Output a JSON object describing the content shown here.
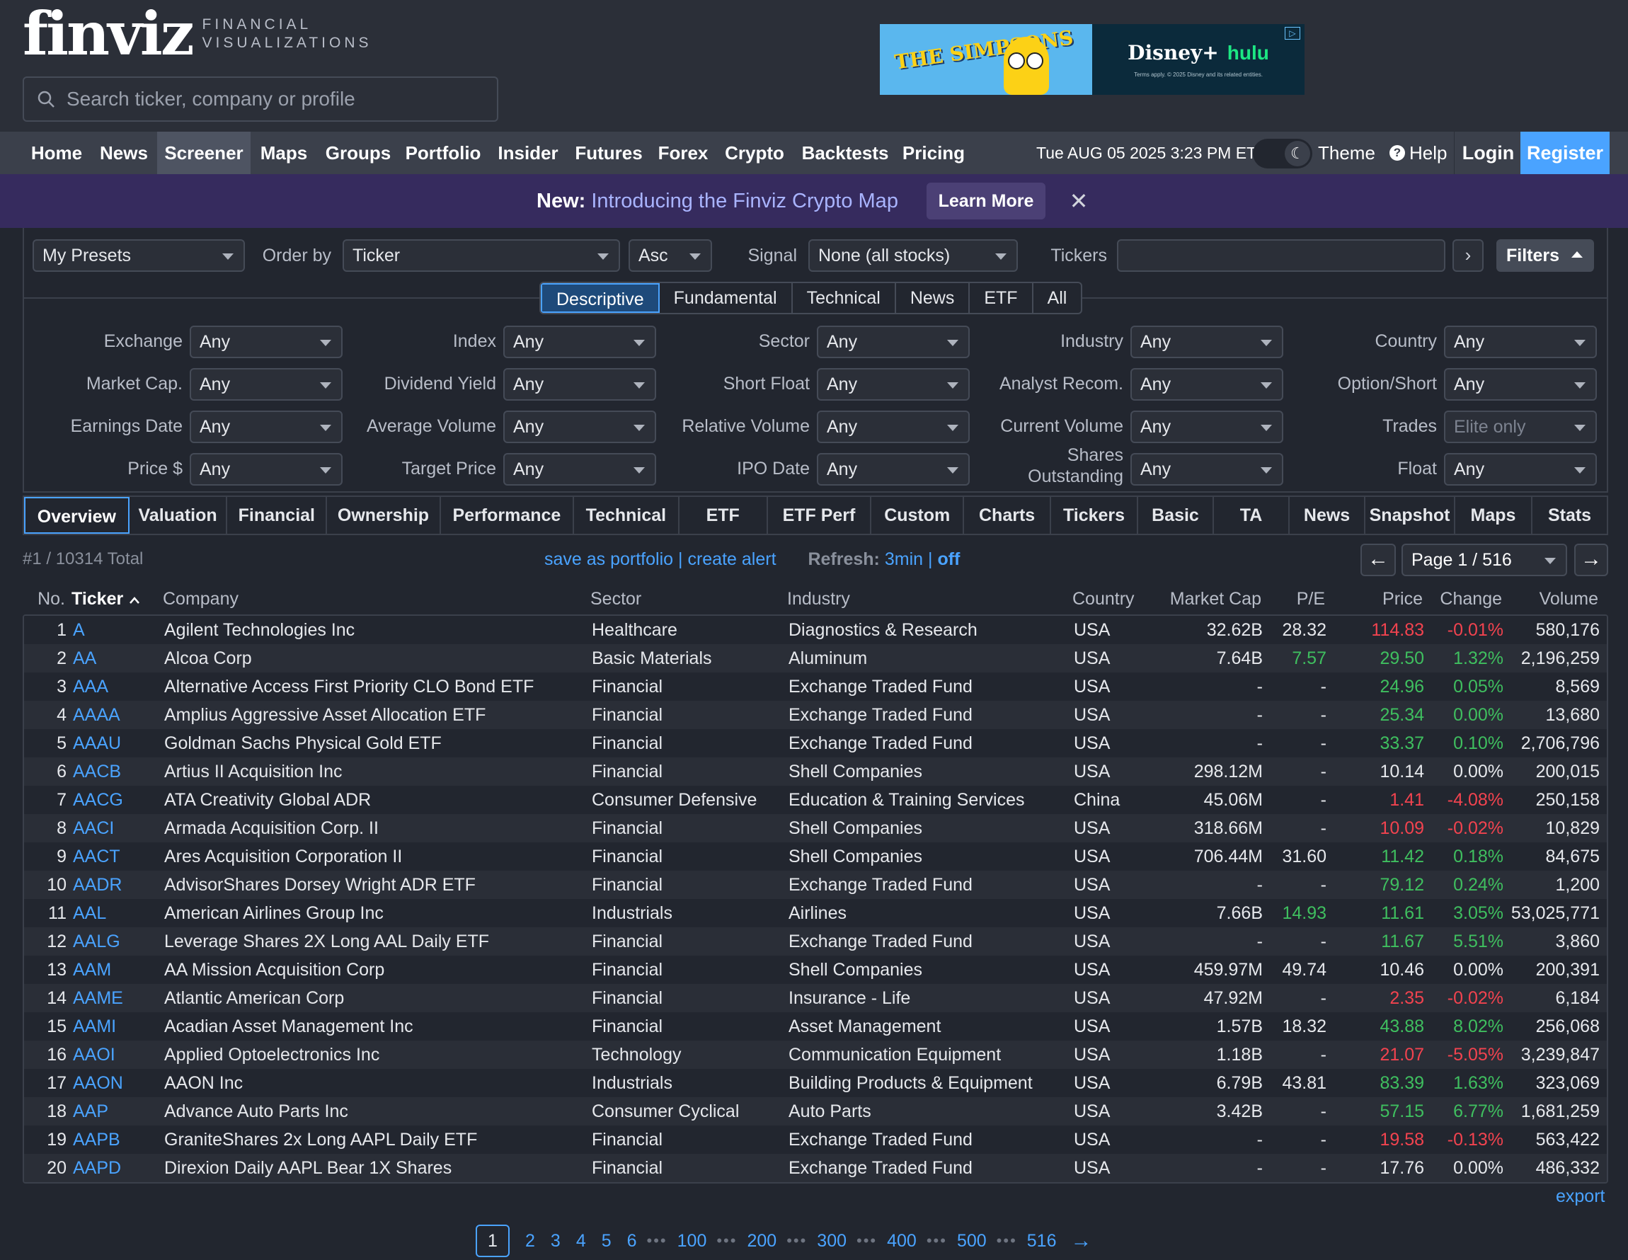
{
  "header": {
    "logo_text": "finviz",
    "logo_sub_1": "FINANCIAL",
    "logo_sub_2": "VISUALIZATIONS",
    "search_placeholder": "Search ticker, company or profile",
    "ad_left": "THE SIMPSONS",
    "ad_brand": "Disney+",
    "ad_brand2": "hulu",
    "ad_small": "Terms apply. © 2025 Disney and its related entities."
  },
  "nav": {
    "items": [
      "Home",
      "News",
      "Screener",
      "Maps",
      "Groups",
      "Portfolio",
      "Insider",
      "Futures",
      "Forex",
      "Crypto",
      "Backtests",
      "Pricing"
    ],
    "active": "Screener",
    "datetime": "Tue AUG 05 2025 3:23 PM ET",
    "theme": "Theme",
    "help": "Help",
    "login": "Login",
    "register": "Register"
  },
  "promo": {
    "prefix": "New:",
    "link": "Introducing the Finviz Crypto Map",
    "button": "Learn More",
    "close": "✕"
  },
  "toolbar": {
    "presets": "My Presets",
    "order_label": "Order by",
    "order_value": "Ticker",
    "direction": "Asc",
    "signal_label": "Signal",
    "signal_value": "None (all stocks)",
    "tickers_label": "Tickers",
    "next": "›",
    "filters": "Filters"
  },
  "filter_tabs": [
    "Descriptive",
    "Fundamental",
    "Technical",
    "News",
    "ETF",
    "All"
  ],
  "filter_active": "Descriptive",
  "filters": [
    {
      "label": "Exchange",
      "value": "Any"
    },
    {
      "label": "Index",
      "value": "Any"
    },
    {
      "label": "Sector",
      "value": "Any"
    },
    {
      "label": "Industry",
      "value": "Any"
    },
    {
      "label": "Country",
      "value": "Any"
    },
    {
      "label": "Market Cap.",
      "value": "Any"
    },
    {
      "label": "Dividend Yield",
      "value": "Any"
    },
    {
      "label": "Short Float",
      "value": "Any"
    },
    {
      "label": "Analyst Recom.",
      "value": "Any"
    },
    {
      "label": "Option/Short",
      "value": "Any"
    },
    {
      "label": "Earnings Date",
      "value": "Any"
    },
    {
      "label": "Average Volume",
      "value": "Any"
    },
    {
      "label": "Relative Volume",
      "value": "Any"
    },
    {
      "label": "Current Volume",
      "value": "Any"
    },
    {
      "label": "Trades",
      "value": "Elite only"
    },
    {
      "label": "Price $",
      "value": "Any"
    },
    {
      "label": "Target Price",
      "value": "Any"
    },
    {
      "label": "IPO Date",
      "value": "Any"
    },
    {
      "label": "Shares Outstanding",
      "value": "Any"
    },
    {
      "label": "Float",
      "value": "Any"
    }
  ],
  "view_tabs": [
    "Overview",
    "Valuation",
    "Financial",
    "Ownership",
    "Performance",
    "Technical",
    "ETF",
    "ETF Perf",
    "Custom",
    "Charts",
    "Tickers",
    "Basic",
    "TA",
    "News",
    "Snapshot",
    "Maps",
    "Stats"
  ],
  "view_active": "Overview",
  "info": {
    "total": "#1 / 10314 Total",
    "save_portfolio": "save as portfolio",
    "sep": "|",
    "create_alert": "create alert",
    "refresh_label": "Refresh:",
    "refresh_value": "3min",
    "refresh_off": "off",
    "page": "Page 1 / 516",
    "prev": "←",
    "next": "→"
  },
  "columns": [
    "No.",
    "Ticker",
    "Company",
    "Sector",
    "Industry",
    "Country",
    "Market Cap",
    "P/E",
    "Price",
    "Change",
    "Volume"
  ],
  "sorted_column": "Ticker",
  "rows": [
    {
      "no": "1",
      "ticker": "A",
      "company": "Agilent Technologies Inc",
      "sector": "Healthcare",
      "industry": "Diagnostics & Research",
      "country": "USA",
      "mcap": "32.62B",
      "pe": "28.32",
      "pe_dir": "",
      "price": "114.83",
      "change": "-0.01%",
      "dir": "neg",
      "volume": "580,176"
    },
    {
      "no": "2",
      "ticker": "AA",
      "company": "Alcoa Corp",
      "sector": "Basic Materials",
      "industry": "Aluminum",
      "country": "USA",
      "mcap": "7.64B",
      "pe": "7.57",
      "pe_dir": "pos",
      "price": "29.50",
      "change": "1.32%",
      "dir": "pos",
      "volume": "2,196,259"
    },
    {
      "no": "3",
      "ticker": "AAA",
      "company": "Alternative Access First Priority CLO Bond ETF",
      "sector": "Financial",
      "industry": "Exchange Traded Fund",
      "country": "USA",
      "mcap": "-",
      "pe": "-",
      "pe_dir": "",
      "price": "24.96",
      "change": "0.05%",
      "dir": "pos",
      "volume": "8,569"
    },
    {
      "no": "4",
      "ticker": "AAAA",
      "company": "Amplius Aggressive Asset Allocation ETF",
      "sector": "Financial",
      "industry": "Exchange Traded Fund",
      "country": "USA",
      "mcap": "-",
      "pe": "-",
      "pe_dir": "",
      "price": "25.34",
      "change": "0.00%",
      "dir": "pos",
      "volume": "13,680"
    },
    {
      "no": "5",
      "ticker": "AAAU",
      "company": "Goldman Sachs Physical Gold ETF",
      "sector": "Financial",
      "industry": "Exchange Traded Fund",
      "country": "USA",
      "mcap": "-",
      "pe": "-",
      "pe_dir": "",
      "price": "33.37",
      "change": "0.10%",
      "dir": "pos",
      "volume": "2,706,796"
    },
    {
      "no": "6",
      "ticker": "AACB",
      "company": "Artius II Acquisition Inc",
      "sector": "Financial",
      "industry": "Shell Companies",
      "country": "USA",
      "mcap": "298.12M",
      "pe": "-",
      "pe_dir": "",
      "price": "10.14",
      "change": "0.00%",
      "dir": "",
      "volume": "200,015"
    },
    {
      "no": "7",
      "ticker": "AACG",
      "company": "ATA Creativity Global ADR",
      "sector": "Consumer Defensive",
      "industry": "Education & Training Services",
      "country": "China",
      "mcap": "45.06M",
      "pe": "-",
      "pe_dir": "",
      "price": "1.41",
      "change": "-4.08%",
      "dir": "neg",
      "volume": "250,158"
    },
    {
      "no": "8",
      "ticker": "AACI",
      "company": "Armada Acquisition Corp. II",
      "sector": "Financial",
      "industry": "Shell Companies",
      "country": "USA",
      "mcap": "318.66M",
      "pe": "-",
      "pe_dir": "",
      "price": "10.09",
      "change": "-0.02%",
      "dir": "neg",
      "volume": "10,829"
    },
    {
      "no": "9",
      "ticker": "AACT",
      "company": "Ares Acquisition Corporation II",
      "sector": "Financial",
      "industry": "Shell Companies",
      "country": "USA",
      "mcap": "706.44M",
      "pe": "31.60",
      "pe_dir": "",
      "price": "11.42",
      "change": "0.18%",
      "dir": "pos",
      "volume": "84,675"
    },
    {
      "no": "10",
      "ticker": "AADR",
      "company": "AdvisorShares Dorsey Wright ADR ETF",
      "sector": "Financial",
      "industry": "Exchange Traded Fund",
      "country": "USA",
      "mcap": "-",
      "pe": "-",
      "pe_dir": "",
      "price": "79.12",
      "change": "0.24%",
      "dir": "pos",
      "volume": "1,200"
    },
    {
      "no": "11",
      "ticker": "AAL",
      "company": "American Airlines Group Inc",
      "sector": "Industrials",
      "industry": "Airlines",
      "country": "USA",
      "mcap": "7.66B",
      "pe": "14.93",
      "pe_dir": "pos",
      "price": "11.61",
      "change": "3.05%",
      "dir": "pos",
      "volume": "53,025,771"
    },
    {
      "no": "12",
      "ticker": "AALG",
      "company": "Leverage Shares 2X Long AAL Daily ETF",
      "sector": "Financial",
      "industry": "Exchange Traded Fund",
      "country": "USA",
      "mcap": "-",
      "pe": "-",
      "pe_dir": "",
      "price": "11.67",
      "change": "5.51%",
      "dir": "pos",
      "volume": "3,860"
    },
    {
      "no": "13",
      "ticker": "AAM",
      "company": "AA Mission Acquisition Corp",
      "sector": "Financial",
      "industry": "Shell Companies",
      "country": "USA",
      "mcap": "459.97M",
      "pe": "49.74",
      "pe_dir": "",
      "price": "10.46",
      "change": "0.00%",
      "dir": "",
      "volume": "200,391"
    },
    {
      "no": "14",
      "ticker": "AAME",
      "company": "Atlantic American Corp",
      "sector": "Financial",
      "industry": "Insurance - Life",
      "country": "USA",
      "mcap": "47.92M",
      "pe": "-",
      "pe_dir": "",
      "price": "2.35",
      "change": "-0.02%",
      "dir": "neg",
      "volume": "6,184"
    },
    {
      "no": "15",
      "ticker": "AAMI",
      "company": "Acadian Asset Management Inc",
      "sector": "Financial",
      "industry": "Asset Management",
      "country": "USA",
      "mcap": "1.57B",
      "pe": "18.32",
      "pe_dir": "",
      "price": "43.88",
      "change": "8.02%",
      "dir": "pos",
      "volume": "256,068"
    },
    {
      "no": "16",
      "ticker": "AAOI",
      "company": "Applied Optoelectronics Inc",
      "sector": "Technology",
      "industry": "Communication Equipment",
      "country": "USA",
      "mcap": "1.18B",
      "pe": "-",
      "pe_dir": "",
      "price": "21.07",
      "change": "-5.05%",
      "dir": "neg",
      "volume": "3,239,847"
    },
    {
      "no": "17",
      "ticker": "AAON",
      "company": "AAON Inc",
      "sector": "Industrials",
      "industry": "Building Products & Equipment",
      "country": "USA",
      "mcap": "6.79B",
      "pe": "43.81",
      "pe_dir": "",
      "price": "83.39",
      "change": "1.63%",
      "dir": "pos",
      "volume": "323,069"
    },
    {
      "no": "18",
      "ticker": "AAP",
      "company": "Advance Auto Parts Inc",
      "sector": "Consumer Cyclical",
      "industry": "Auto Parts",
      "country": "USA",
      "mcap": "3.42B",
      "pe": "-",
      "pe_dir": "",
      "price": "57.15",
      "change": "6.77%",
      "dir": "pos",
      "volume": "1,681,259"
    },
    {
      "no": "19",
      "ticker": "AAPB",
      "company": "GraniteShares 2x Long AAPL Daily ETF",
      "sector": "Financial",
      "industry": "Exchange Traded Fund",
      "country": "USA",
      "mcap": "-",
      "pe": "-",
      "pe_dir": "",
      "price": "19.58",
      "change": "-0.13%",
      "dir": "neg",
      "volume": "563,422"
    },
    {
      "no": "20",
      "ticker": "AAPD",
      "company": "Direxion Daily AAPL Bear 1X Shares",
      "sector": "Financial",
      "industry": "Exchange Traded Fund",
      "country": "USA",
      "mcap": "-",
      "pe": "-",
      "pe_dir": "",
      "price": "17.76",
      "change": "0.00%",
      "dir": "",
      "volume": "486,332"
    }
  ],
  "export": "export",
  "pagination": {
    "pages": [
      "1",
      "2",
      "3",
      "4",
      "5",
      "6",
      "100",
      "200",
      "300",
      "400",
      "500",
      "516"
    ],
    "dots": "•••",
    "next": "→"
  },
  "colors": {
    "accent": "#4aa3ff",
    "positive": "#3fbf5f",
    "negative": "#f2434f",
    "nav_bg": "#3b404b",
    "promo_bg": "#362b5e"
  }
}
